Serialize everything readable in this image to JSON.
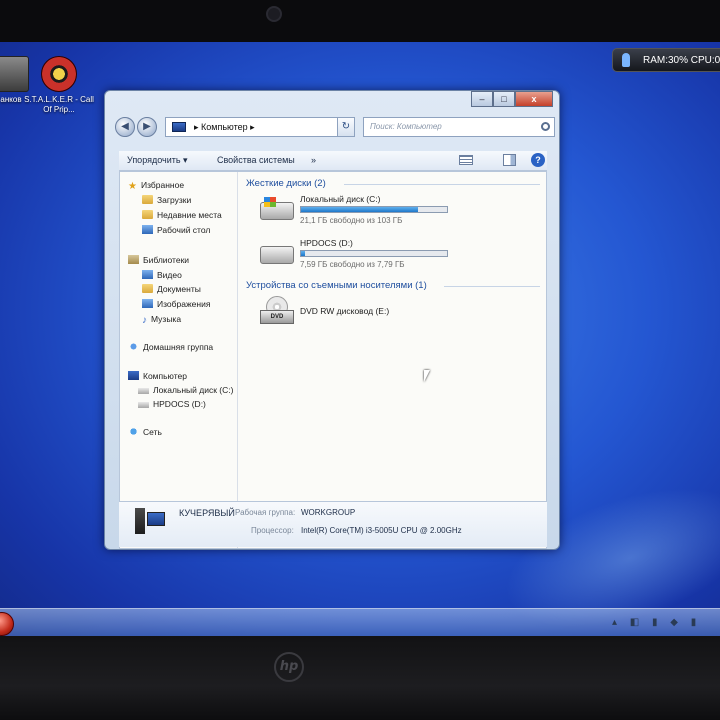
{
  "desktop": {
    "icons": [
      {
        "label": "анков"
      },
      {
        "label": "S.T.A.L.K.E.R - Call Of Prip..."
      }
    ],
    "gadget": {
      "text": "RAM:30%  CPU:0"
    }
  },
  "window": {
    "caption": {
      "minimize": "–",
      "maximize": "□",
      "close": "x"
    },
    "nav": {
      "back": "◀",
      "forward": "▶"
    },
    "address": {
      "path": "▸ Компьютер ▸"
    },
    "refresh": "↻",
    "search": {
      "placeholder": "Поиск: Компьютер"
    },
    "toolbar": {
      "organize": "Упорядочить ▾",
      "system_properties": "Свойства системы",
      "more": "»"
    },
    "nav_pane": {
      "favorites": "Избранное",
      "downloads": "Загрузки",
      "recent": "Недавние места",
      "desktop": "Рабочий стол",
      "libraries": "Библиотеки",
      "video": "Видео",
      "documents": "Документы",
      "pictures": "Изображения",
      "music": "Музыка",
      "homegroup": "Домашняя группа",
      "computer": "Компьютер",
      "drive_c": "Локальный диск (C:)",
      "drive_d": "HPDOCS (D:)",
      "network": "Сеть"
    },
    "groups": {
      "hard_disks": "Жесткие диски (2)",
      "removable": "Устройства со съемными носителями (1)"
    },
    "drives": [
      {
        "name": "Локальный диск (C:)",
        "free": "21,1 ГБ свободно из 103 ГБ",
        "used_fraction": 0.8
      },
      {
        "name": "HPDOCS (D:)",
        "free": "7,59 ГБ свободно из 7,79 ГБ",
        "used_fraction": 0.03
      },
      {
        "name": "DVD RW дисковод (E:)",
        "badge": "DVD"
      }
    ],
    "details": {
      "computer_name": "КУЧЕРЯВЫЙ",
      "workgroup_label": "Рабочая группа:",
      "workgroup": "WORKGROUP",
      "cpu_label": "Процессор:",
      "cpu": "Intel(R) Core(TM) i3-5005U CPU @ 2.00GHz"
    }
  },
  "bezel": {
    "logo": "hp"
  },
  "colors": {
    "accent": "#1e4e9e",
    "desktop": "#2457d2",
    "bar": "#1f77c9"
  }
}
